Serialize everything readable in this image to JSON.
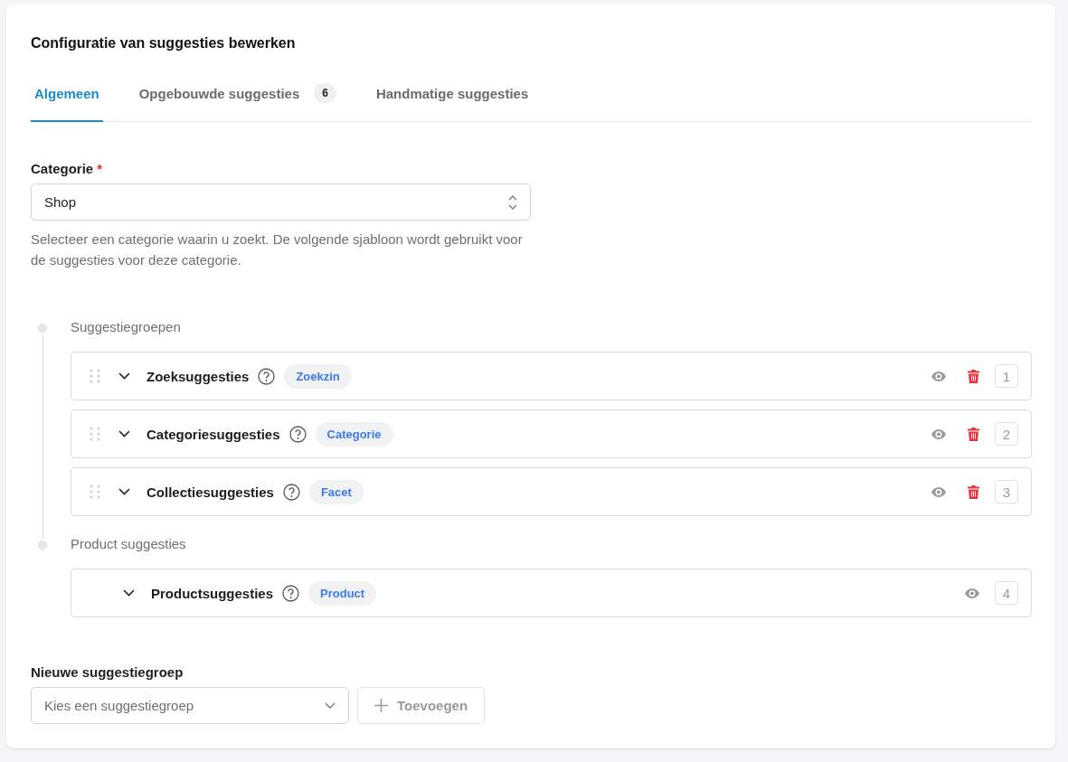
{
  "title": "Configuratie van suggesties bewerken",
  "tabs": [
    {
      "label": "Algemeen",
      "selected": true
    },
    {
      "label": "Opgebouwde suggesties",
      "badge": "6",
      "selected": false
    },
    {
      "label": "Handmatige suggesties",
      "selected": false
    }
  ],
  "category": {
    "label": "Categorie",
    "required_mark": "*",
    "value": "Shop",
    "help": "Selecteer een categorie waarin u zoekt. De volgende sjabloon wordt gebruikt voor de suggesties voor deze categorie."
  },
  "groups": [
    {
      "label": "Suggestiegroepen",
      "rows": [
        {
          "title": "Zoeksuggesties",
          "tag": "Zoekzin",
          "number": "1",
          "draggable": true,
          "deletable": true
        },
        {
          "title": "Categoriesuggesties",
          "tag": "Categorie",
          "number": "2",
          "draggable": true,
          "deletable": true
        },
        {
          "title": "Collectiesuggesties",
          "tag": "Facet",
          "number": "3",
          "draggable": true,
          "deletable": true
        }
      ]
    },
    {
      "label": "Product suggesties",
      "rows": [
        {
          "title": "Productsuggesties",
          "tag": "Product",
          "number": "4",
          "draggable": false,
          "deletable": false
        }
      ]
    }
  ],
  "new_group": {
    "label": "Nieuwe suggestiegroep",
    "placeholder": "Kies een suggestiegroep",
    "button": "Toevoegen"
  }
}
